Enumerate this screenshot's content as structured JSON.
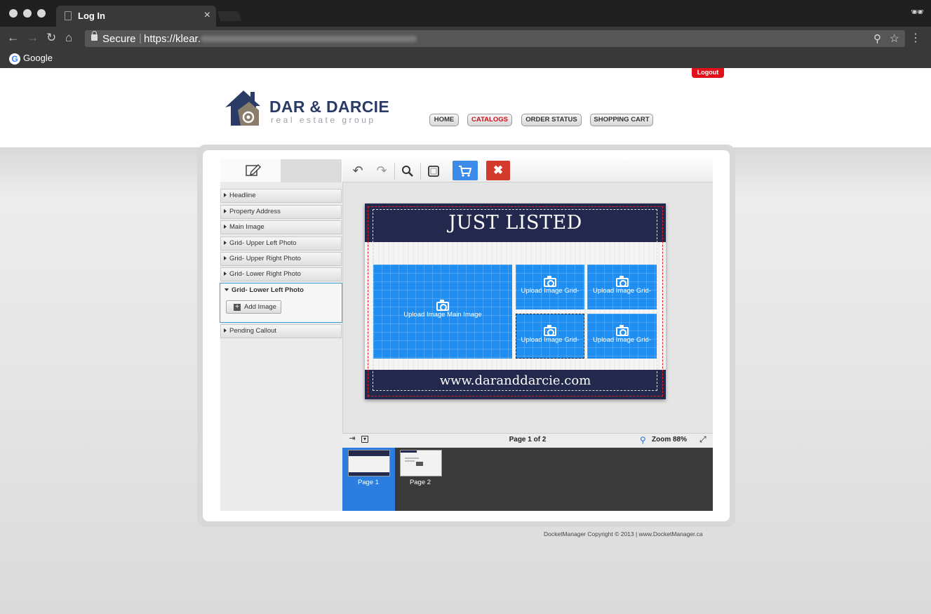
{
  "browser": {
    "tab_title": "Log In",
    "secure_label": "Secure",
    "url_visible": "https://klear.",
    "bookmark_label": "Google"
  },
  "header": {
    "logout_label": "Logout",
    "logo_name": "DAR & DARCIE",
    "logo_sub": "real estate group",
    "nav": [
      {
        "label": "HOME",
        "active": false
      },
      {
        "label": "CATALOGS",
        "active": true
      },
      {
        "label": "ORDER STATUS",
        "active": false
      },
      {
        "label": "SHOPPING CART",
        "active": false
      }
    ]
  },
  "sidebar": {
    "items": [
      {
        "label": "Headline"
      },
      {
        "label": "Property Address"
      },
      {
        "label": "Main Image"
      },
      {
        "label": "Grid- Upper Left Photo"
      },
      {
        "label": "Grid- Upper Right Photo"
      },
      {
        "label": "Grid- Lower Right Photo"
      },
      {
        "label": "Grid- Lower Left Photo",
        "expanded": true
      },
      {
        "label": "Pending Callout"
      }
    ],
    "add_image_label": "Add Image"
  },
  "card": {
    "headline": "JUST LISTED",
    "url": "www.daranddarcie.com",
    "main_placeholder": "Upload Image Main Image",
    "grid_placeholder": "Upload Image Grid-"
  },
  "status": {
    "page_info": "Page 1 of 2",
    "zoom": "Zoom 88%"
  },
  "pages": [
    {
      "label": "Page 1",
      "active": true
    },
    {
      "label": "Page 2",
      "active": false
    }
  ],
  "footer": {
    "copyright": "DocketManager Copyright © 2013 | www.DocketManager.ca"
  },
  "colors": {
    "brand_navy": "#22294d",
    "placeholder_blue": "#1f8ef0",
    "cart_blue": "#3d8be8",
    "close_red": "#d33a2c",
    "active_nav_red": "#d20f1a"
  }
}
